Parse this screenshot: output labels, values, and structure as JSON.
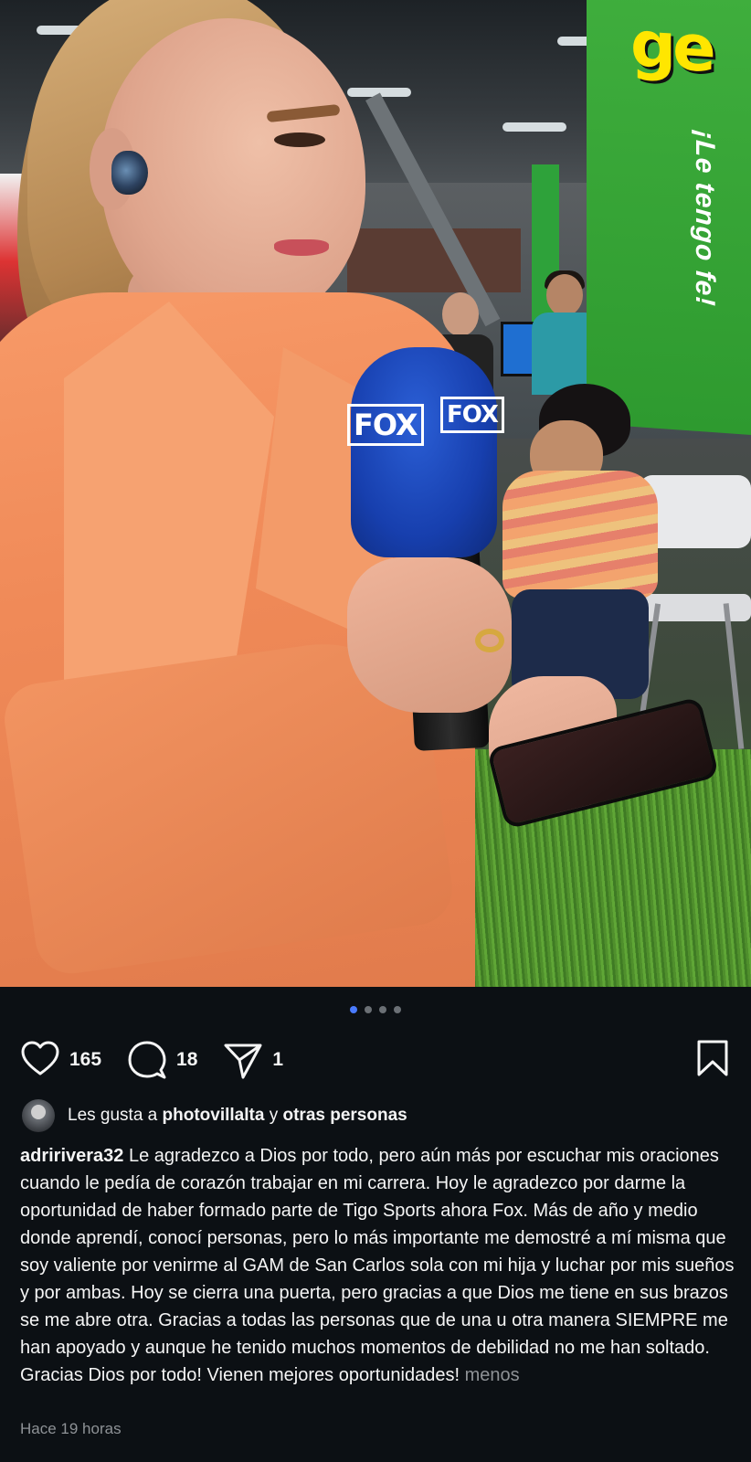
{
  "post": {
    "image_alt": "Presentadora con micrófono FOX",
    "banner_logo": "ge",
    "banner_slogan": "¡Le tengo fe!",
    "mic_logo": "FOX",
    "carousel": {
      "count": 4,
      "active_index": 0
    }
  },
  "actions": {
    "likes": "165",
    "comments": "18",
    "shares": "1"
  },
  "liked_by": {
    "prefix": "Les gusta a",
    "user": "photovillalta",
    "connector": "y",
    "others": "otras personas"
  },
  "caption": {
    "username": "adririvera32",
    "text": "Le agradezco a Dios por todo, pero aún más por escuchar mis oraciones cuando le pedía de corazón trabajar en mi carrera. Hoy le agradezco por darme la oportunidad de haber formado parte de Tigo Sports ahora Fox. Más de año y medio donde aprendí, conocí personas, pero lo más importante me demostré a mí misma que soy valiente por venirme al GAM de San Carlos sola con mi hija y luchar por mis sueños y por ambas. Hoy se cierra una puerta, pero gracias a que Dios me tiene en sus brazos se me abre otra. Gracias a todas las personas que de una u otra manera SIEMPRE me han apoyado y aunque he tenido muchos momentos de debilidad no me han soltado. Gracias Dios por todo! Vienen mejores oportunidades!",
    "less_label": "menos"
  },
  "timestamp": "Hace 19 horas",
  "colors": {
    "background": "#0c1014",
    "text": "#f5f5f5",
    "secondary": "#8e9296",
    "active_dot": "#4a7bff"
  },
  "icons": {
    "like": "heart-icon",
    "comment": "comment-bubble-icon",
    "share": "send-icon",
    "save": "bookmark-icon"
  }
}
